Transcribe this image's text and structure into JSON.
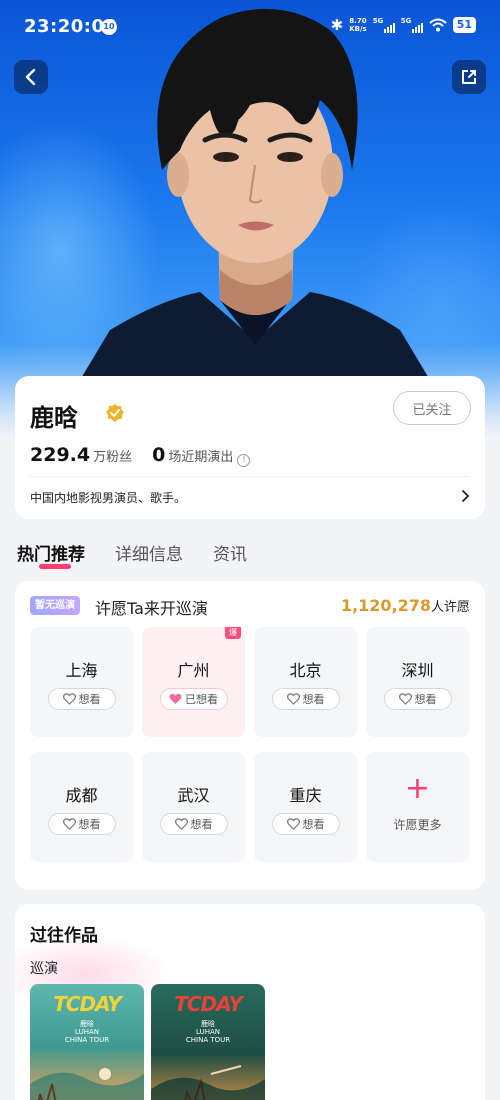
{
  "status_bar": {
    "time": "23:20:00",
    "badge": "10",
    "net_speed_value": "8.70",
    "net_speed_unit": "KB/s",
    "sim1": "5G",
    "sim2": "5G",
    "battery": "51"
  },
  "artist": {
    "name": "鹿晗",
    "follow_label": "已关注",
    "fans_value": "229.4",
    "fans_label": "万粉丝",
    "shows_value": "0",
    "shows_label": "场近期演出",
    "bio": "中国内地影视男演员、歌手。"
  },
  "tabs": [
    "热门推荐",
    "详细信息",
    "资讯"
  ],
  "wish": {
    "tag": "暂无巡演",
    "title": "许愿Ta来开巡演",
    "count": "1,120,278",
    "count_suffix": "人许愿",
    "hot_badge": "爆",
    "want_label": "想看",
    "wanted_label": "已想看",
    "more_label": "许愿更多",
    "cities": [
      {
        "name": "上海",
        "selected": false
      },
      {
        "name": "广州",
        "selected": true
      },
      {
        "name": "北京",
        "selected": false
      },
      {
        "name": "深圳",
        "selected": false
      },
      {
        "name": "成都",
        "selected": false
      },
      {
        "name": "武汉",
        "selected": false
      },
      {
        "name": "重庆",
        "selected": false
      }
    ]
  },
  "works": {
    "title": "过往作品",
    "subtitle": "巡演",
    "posters": [
      {
        "logo": "TCDAY",
        "line1": "鹿晗",
        "line2": "LUHAN",
        "line3": "CHINA TOUR"
      },
      {
        "logo": "TCDAY",
        "line1": "鹿晗",
        "line2": "LUHAN",
        "line3": "CHINA TOUR"
      }
    ]
  },
  "colors": {
    "accent": "#ff3d6f",
    "verified": "#f0b429",
    "wish_count": "#d99a2b",
    "hero_blue": "#1a78ee"
  },
  "icons": {
    "back": "chevron-left-icon",
    "share": "share-icon",
    "verified": "verified-badge-icon",
    "heart": "heart-icon",
    "plus": "plus-icon"
  }
}
